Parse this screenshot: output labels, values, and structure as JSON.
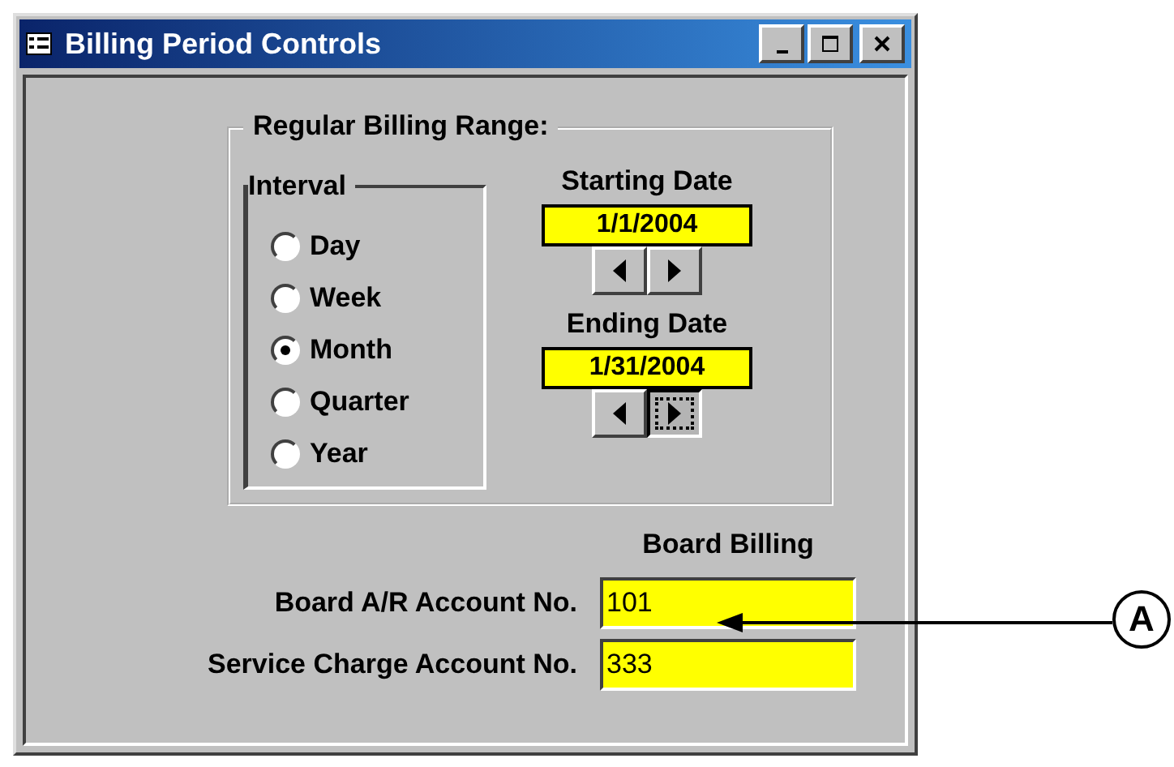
{
  "window": {
    "title": "Billing Period Controls"
  },
  "range": {
    "title": "Regular Billing Range:",
    "interval": {
      "title": "Interval",
      "options": [
        {
          "label": "Day",
          "selected": false
        },
        {
          "label": "Week",
          "selected": false
        },
        {
          "label": "Month",
          "selected": true
        },
        {
          "label": "Quarter",
          "selected": false
        },
        {
          "label": "Year",
          "selected": false
        }
      ]
    },
    "dates": [
      {
        "label": "Starting Date",
        "value": "1/1/2004",
        "next_focused": false
      },
      {
        "label": "Ending Date",
        "value": "1/31/2004",
        "next_focused": true
      }
    ]
  },
  "accounts": {
    "heading": "Board Billing",
    "fields": [
      {
        "label": "Board A/R Account No.",
        "value": "101"
      },
      {
        "label": "Service Charge Account No.",
        "value": "333"
      }
    ]
  },
  "callout": {
    "label": "A"
  }
}
